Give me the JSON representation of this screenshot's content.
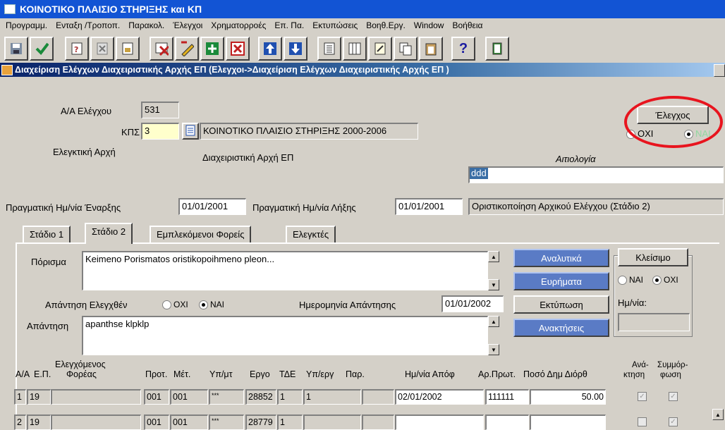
{
  "app": {
    "title": "ΚΟΙΝΟΤΙΚΟ ΠΛΑΙΣΙΟ ΣΤΗΡΙΞΗΣ και ΚΠ"
  },
  "menu": [
    "Προγραμμ.",
    "Ενταξη /Τροποπ.",
    "Παρακολ.",
    "Έλεγχοι",
    "Χρηματορροές",
    "Επ. Πα.",
    "Εκτυπώσεις",
    "Βοηθ.Εργ.",
    "Window",
    "Βοήθεια"
  ],
  "toolbar": {
    "help_label": "?"
  },
  "window": {
    "title": "Διαχείριση Ελέγχων Διαχειριστικής Αρχής ΕΠ (Ελεγχοι->Διαχείριση Ελέγχων Διαχειριστικής Αρχής ΕΠ )"
  },
  "form": {
    "aa_label": "Α/Α Ελέγχου",
    "aa_value": "531",
    "kps_label": "ΚΠΣ",
    "kps_value": "3",
    "kps_desc": "ΚΟΙΝΟΤΙΚΟ ΠΛΑΙΣΙΟ ΣΤΗΡΙΞΗΣ 2000-2006",
    "elegktiki_label": "Ελεγκτική Αρχή",
    "diax_label": "Διαχειριστική Αρχή ΕΠ",
    "aitiologia_label": "Αιτιολογία",
    "aitiologia_value": "ddd",
    "elegxos_button": "Έλεγχος",
    "radio_oxi": "ΟΧΙ",
    "radio_nai": "ΝΑΙ",
    "start_label": "Πραγματική Ημ/νία Έναρξης",
    "start_value": "01/01/2001",
    "end_label": "Πραγματική Ημ/νία Λήξης",
    "end_value": "01/01/2001",
    "stage_value": "Οριστικοποίηση Αρχικού Ελέγχου (Στάδιο 2)"
  },
  "tabs": [
    "Στάδιο 1",
    "Στάδιο 2",
    "Εμπλεκόμενοι Φορείς",
    "Ελεγκτές"
  ],
  "stage2": {
    "porisma_label": "Πόρισμα",
    "porisma_value": "Keimeno Porismatos oristikopoihmeno pleon...",
    "apantisi_elegx_label": "Απάντηση Ελεγχθέν",
    "radio_oxi": "ΟΧΙ",
    "radio_nai": "ΝΑΙ",
    "date_apantisis_label": "Ημερομηνία Απάντησης",
    "date_apantisis_value": "01/01/2002",
    "apantisi_label": "Απάντηση",
    "apantisi_value": "apanthse klpklp",
    "btn_analytika": "Αναλυτικά",
    "btn_evrimata": "Ευρήματα",
    "btn_ektyposi": "Εκτύπωση",
    "btn_anaktiseis": "Ανακτήσεις",
    "btn_kleisimo": "Κλείσιμο",
    "kleisimo_nai": "ΝΑΙ",
    "kleisimo_oxi": "ΟΧΙ",
    "hmnia_label": "Ημ/νία:"
  },
  "table": {
    "headers": {
      "aa": "Α/Α",
      "ep": "Ε.Π.",
      "foreas_top": "Ελεγχόμενος",
      "foreas": "Φορέας",
      "prot": "Προτ.",
      "met": "Μέτ.",
      "ypmt": "Υπ/μτ",
      "ergo": "Εργο",
      "tde": "ΤΔΕ",
      "yperg": "Υπ/εργ",
      "par": "Παρ.",
      "hmapof": "Ημ/νία Απόφ",
      "arprot": "Αρ.Πρωτ.",
      "poso": "Ποσό Δημ Διόρθ",
      "anakt_top": "Ανά-",
      "anakt": "κτηση",
      "symm_top": "Συμμόρ-",
      "symm": "φωση"
    },
    "rows": [
      {
        "aa": "1",
        "ep": "19",
        "foreas": "",
        "prot": "001",
        "met": "001",
        "ypmt": "***",
        "ergo": "28852",
        "tde": "1",
        "yperg": "1",
        "par": "",
        "hmapof": "02/01/2002",
        "arprot": "111111",
        "poso": "50.00",
        "anakt": true,
        "symm": true
      },
      {
        "aa": "2",
        "ep": "19",
        "foreas": "",
        "prot": "001",
        "met": "001",
        "ypmt": "***",
        "ergo": "28779",
        "tde": "1",
        "yperg": "",
        "par": "",
        "hmapof": "",
        "arprot": "",
        "poso": "",
        "anakt": false,
        "symm": true
      }
    ]
  },
  "colors": {
    "titlebar": "#1254d4",
    "window_title": "#0a246a",
    "button_blue": "#5a7bc5",
    "annotation_circle": "#e8141e",
    "kps_field": "#ffffcc"
  }
}
